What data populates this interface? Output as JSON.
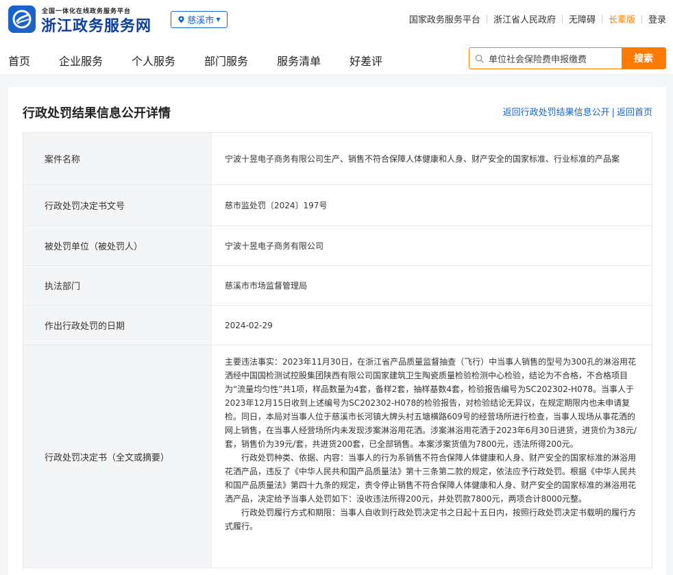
{
  "header": {
    "logo_sub": "全国一体化在线政务服务平台",
    "logo_main": "浙江政务服务网",
    "region": "慈溪市",
    "top_links": [
      "国家政务服务平台",
      "浙江省人民政府",
      "无障碍",
      "长辈版",
      "登录"
    ],
    "nav": [
      "首页",
      "企业服务",
      "个人服务",
      "部门服务",
      "服务清单",
      "好差评"
    ],
    "search": {
      "value": "单位社会保险费申报缴费",
      "button": "搜索"
    }
  },
  "colors": {
    "brand_blue": "#1a63c8",
    "accent_orange": "#ff7a00"
  },
  "page": {
    "title": "行政处罚结果信息公开详情",
    "back_links": [
      "返回行政处罚结果信息公开",
      "返回首页"
    ],
    "separator": "|"
  },
  "rows": [
    {
      "label": "案件名称",
      "value": "宁波十昱电子商务有限公司生产、销售不符合保障人体健康和人身、财产安全的国家标准、行业标准的产品案"
    },
    {
      "label": "行政处罚决定书文号",
      "value": "慈市监处罚〔2024〕197号"
    },
    {
      "label": "被处罚单位（被处罚人）",
      "value": "宁波十昱电子商务有限公司"
    },
    {
      "label": "执法部门",
      "value": "慈溪市市场监督管理局"
    },
    {
      "label": "作出行政处罚的日期",
      "value": "2024-02-29"
    }
  ],
  "decision": {
    "label": "行政处罚决定书（全文或摘要）",
    "paragraphs": [
      "主要违法事实：2023年11月30日，在浙江省产品质量监督抽查（飞行）中当事人销售的型号为300孔的淋浴用花洒经中国国检测试控股集团陕西有限公司国家建筑卫生陶瓷质量检验检测中心检验，结论为不合格，不合格项目为“流量均匀性”共1项，样品数量为4套，备样2套，抽样基数4套，检验报告编号为SC202302-H078。当事人于2023年12月15日收到上述编号为SC202302-H078的检验报告，对检验结论无异议，在规定期限内也未申请复检。同日，本局对当事人位于慈溪市长河镇大牌头村五塘横路609号的经营场所进行检查，当事人现场从事花洒的网上销售，在当事人经营场所内未发现涉案淋浴用花洒。涉案淋浴用花洒于2023年6月30日进货，进货价为38元/套，销售价为39元/套，共进货200套，已全部销售。本案涉案货值为7800元，违法所得200元。",
      "行政处罚种类、依据、内容：当事人的行为系销售不符合保障人体健康和人身、财产安全的国家标准的淋浴用花洒产品，违反了《中华人民共和国产品质量法》第十三条第二款的规定，依法应予行政处罚。根据《中华人民共和国产品质量法》第四十九条的规定，责令停止销售不符合保障人体健康和人身、财产安全的国家标准的淋浴用花洒产品，决定给予当事人处罚如下：没收违法所得200元，并处罚款7800元，两项合计8000元整。",
      "行政处罚履行方式和期限：当事人自收到行政处罚决定书之日起十五日内，按照行政处罚决定书载明的履行方式履行。"
    ]
  }
}
